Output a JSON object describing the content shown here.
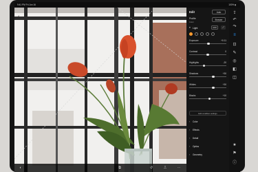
{
  "status_bar": {
    "time": "9:41 PM  Fri Jun 16",
    "system": "100% ▮"
  },
  "photo": {
    "back_glyph": "‹"
  },
  "panel": {
    "title": "Edit",
    "auto_label": "Auto",
    "profile": {
      "label": "Profile",
      "value": "Color",
      "browse_label": "Browse"
    },
    "light_section": {
      "label": "Light",
      "hdr_label": "HDR",
      "chevron": "▾"
    },
    "swatches_active_color": "#ff9a2e",
    "sliders": [
      {
        "label": "Exposure",
        "value": "+0.11",
        "level": 0.52
      },
      {
        "label": "Contrast",
        "value": "0",
        "level": 0.5
      },
      {
        "label": "Highlights",
        "value": "-20",
        "level": 0.4
      },
      {
        "label": "Shadows",
        "value": "+30",
        "level": 0.65
      },
      {
        "label": "Whites",
        "value": "+30",
        "level": 0.65
      },
      {
        "label": "Blacks",
        "value": "+10",
        "level": 0.55
      }
    ],
    "edit_conditions_label": "Edit condition settings",
    "collapsed_sections": [
      "Color",
      "Effects",
      "Detail",
      "Optics",
      "Geometry"
    ],
    "collapsed_chevron": "›"
  },
  "rail_icons": [
    {
      "name": "share-icon",
      "glyph": "⇪"
    },
    {
      "name": "undo-icon",
      "glyph": "↶"
    },
    {
      "name": "redo-icon",
      "glyph": "↷"
    },
    {
      "name": "sliders-icon",
      "glyph": "≡"
    },
    {
      "name": "crop-icon",
      "glyph": "⊡"
    },
    {
      "name": "heal-icon",
      "glyph": "✎"
    },
    {
      "name": "mask-icon",
      "glyph": "◎"
    },
    {
      "name": "presets-icon",
      "glyph": "◧"
    },
    {
      "name": "versions-icon",
      "glyph": "◫"
    },
    {
      "name": "star-icon",
      "glyph": "★"
    },
    {
      "name": "flag-icon",
      "glyph": "⚑"
    },
    {
      "name": "info-icon",
      "glyph": "ⓘ"
    }
  ],
  "overlay_toolbar": [
    {
      "name": "compare-icon",
      "glyph": "◐"
    },
    {
      "name": "copy-icon",
      "glyph": "⧉"
    },
    {
      "name": "reset-icon",
      "glyph": "↺"
    },
    {
      "name": "before-after-icon",
      "glyph": "⎍"
    },
    {
      "name": "more-icon",
      "glyph": "⋯"
    }
  ]
}
